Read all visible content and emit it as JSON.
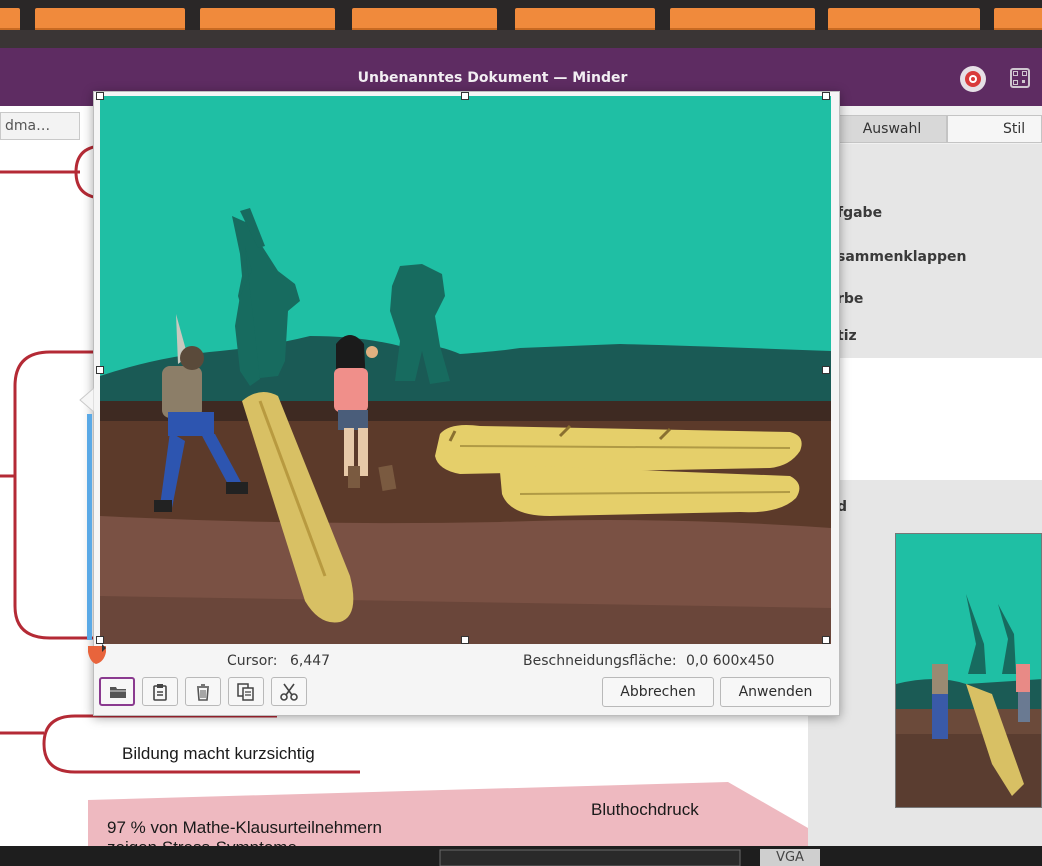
{
  "window": {
    "title": "Unbenanntes Dokument — Minder",
    "header_icons": [
      "target-icon",
      "qr-code-icon"
    ]
  },
  "canvas": {
    "left_tab_label": "dma…",
    "nodes": [
      "Bildung macht kurzsichtig",
      "Bluthochdruck",
      "97 % von Mathe-Klausurteilnehmern",
      "zeigen Stress-Symptome"
    ]
  },
  "sidebar": {
    "tabs": [
      "Auswahl",
      "Stil"
    ],
    "labels": [
      "fgabe",
      "sammenklappen",
      "rbe",
      "tiz",
      "d"
    ]
  },
  "crop_dialog": {
    "cursor_label": "Cursor:",
    "cursor_value": "6,447",
    "crop_label": "Beschneidungsfläche:",
    "crop_value": "0,0 600x450",
    "tool_icons": [
      "folder-open-icon",
      "paste-icon",
      "delete-icon",
      "copy-icon",
      "cut-icon"
    ],
    "cancel_label": "Abbrechen",
    "apply_label": "Anwenden"
  },
  "desk": {
    "connector_label": "VGA"
  },
  "colors": {
    "titlebar": "#5e2c62",
    "photo_background": "#1fbfa4",
    "mindmap_line": "#b42a35",
    "pink_node": "#eeb9c0",
    "selection_blue": "#5aa9e6"
  }
}
